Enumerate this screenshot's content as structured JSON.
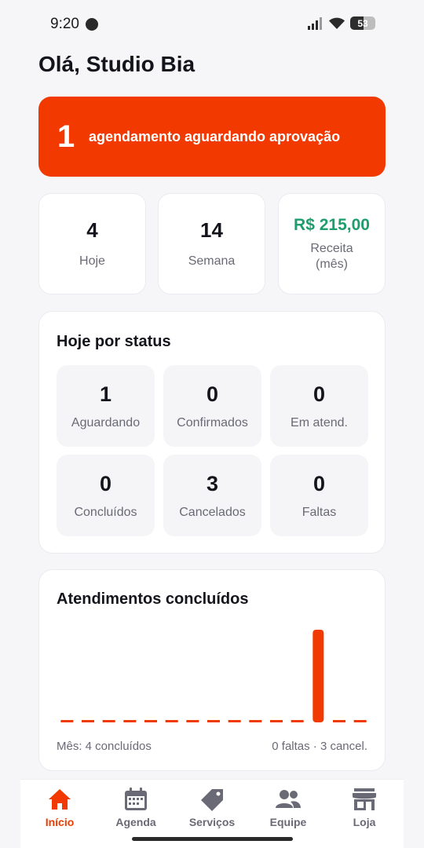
{
  "status_bar": {
    "time": "9:20",
    "battery": "53"
  },
  "greeting": "Olá, Studio Bia",
  "alert": {
    "count": "1",
    "text": "agendamento aguardando aprovação"
  },
  "stats": [
    {
      "value": "4",
      "label": "Hoje"
    },
    {
      "value": "14",
      "label": "Semana"
    },
    {
      "value": "R$ 215,00",
      "label": "Receita (mês)"
    }
  ],
  "status_panel": {
    "title": "Hoje por status",
    "items": [
      {
        "value": "1",
        "label": "Aguardando"
      },
      {
        "value": "0",
        "label": "Confirmados"
      },
      {
        "value": "0",
        "label": "Em atend."
      },
      {
        "value": "0",
        "label": "Concluídos"
      },
      {
        "value": "3",
        "label": "Cancelados"
      },
      {
        "value": "0",
        "label": "Faltas"
      }
    ]
  },
  "completed_panel": {
    "title": "Atendimentos concluídos",
    "footer_left": "Mês: 4 concluídos",
    "footer_right": "0 faltas · 3 cancel."
  },
  "chart_data": {
    "type": "bar",
    "values": [
      0,
      0,
      0,
      0,
      0,
      0,
      0,
      0,
      0,
      0,
      0,
      0,
      4,
      0,
      0
    ],
    "ylim": [
      0,
      4
    ],
    "color": "#f23a00"
  },
  "nav": {
    "items": [
      {
        "label": "Início",
        "icon": "home-icon",
        "active": true
      },
      {
        "label": "Agenda",
        "icon": "calendar-icon",
        "active": false
      },
      {
        "label": "Serviços",
        "icon": "tag-icon",
        "active": false
      },
      {
        "label": "Equipe",
        "icon": "people-icon",
        "active": false
      },
      {
        "label": "Loja",
        "icon": "store-icon",
        "active": false
      }
    ],
    "active_color": "#f23a00",
    "inactive_color": "#6a6a76"
  }
}
